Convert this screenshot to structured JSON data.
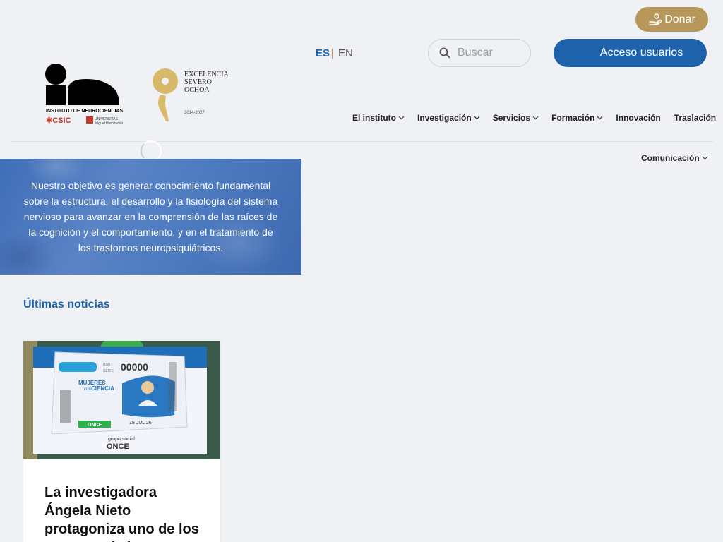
{
  "header": {
    "donate_label": "Donar",
    "lang": {
      "active": "ES",
      "other": "EN"
    },
    "search_placeholder": "Buscar",
    "access_label": "Acceso usuarios",
    "logo_in_caption": "INSTITUTO DE NEUROCIENCIAS",
    "logo_so_lines": [
      "EXCELENCIA",
      "SEVERO",
      "OCHOA"
    ],
    "logo_so_years": "2014-2027"
  },
  "nav": {
    "items": [
      {
        "label": "El instituto",
        "has_dropdown": true
      },
      {
        "label": "Investigación",
        "has_dropdown": true
      },
      {
        "label": "Servicios",
        "has_dropdown": true
      },
      {
        "label": "Formación",
        "has_dropdown": true
      },
      {
        "label": "Innovación",
        "has_dropdown": false
      },
      {
        "label": "Traslación",
        "has_dropdown": false
      },
      {
        "label": "Comunicación",
        "has_dropdown": true
      }
    ]
  },
  "hero": {
    "text": "Nuestro objetivo es generar conocimiento fundamental sobre la estructura, el desarrollo y la fisiología del sistema nervioso para avanzar en la comprensión de las raíces de la cognición y el comportamiento, y en el tratamiento de los trastornos neuropsiquiátricos."
  },
  "news": {
    "section_title": "Últimas noticias",
    "cards": [
      {
        "headline": "La investigadora Ángela Nieto protagoniza uno de los cupones de la…",
        "image_text": {
          "number": "00000",
          "serie_number": "000",
          "serie_label": "SERIE",
          "campaign_line1": "MUJERES",
          "campaign_line2": "con",
          "campaign_line3": "CIENCIA",
          "brand": "ONCE",
          "date": "18 JUL 26",
          "group": "grupo social"
        }
      }
    ]
  },
  "colors": {
    "primary": "#1d62ab",
    "gold": "#b8985a",
    "background": "#eff1f4"
  }
}
